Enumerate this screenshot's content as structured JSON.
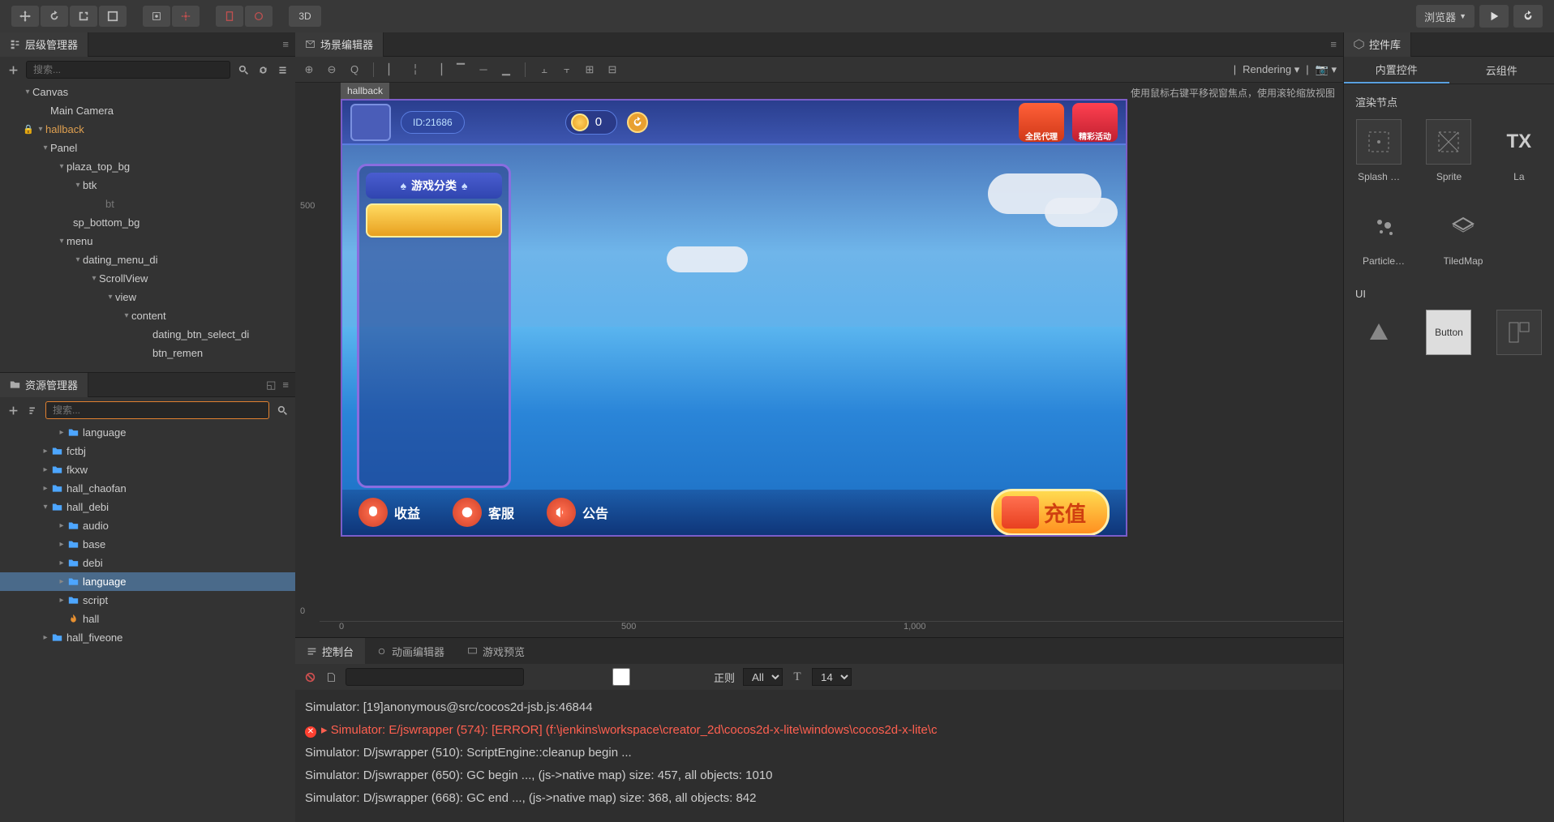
{
  "toolbar": {
    "btn3d": "3D",
    "browser": "浏览器"
  },
  "panels": {
    "hierarchy_title": "层级管理器",
    "assets_title": "资源管理器",
    "scene_title": "场景编辑器",
    "widgets_title": "控件库",
    "console_title": "控制台",
    "anim_title": "动画编辑器",
    "preview_title": "游戏预览"
  },
  "search": {
    "placeholder": "搜索..."
  },
  "hierarchy": {
    "items": [
      {
        "pad": 28,
        "caret": "▾",
        "label": "Canvas"
      },
      {
        "pad": 50,
        "caret": "",
        "label": "Main Camera"
      },
      {
        "pad": 28,
        "caret": "▾",
        "label": "hallback",
        "active": true,
        "lock": true
      },
      {
        "pad": 50,
        "caret": "▾",
        "label": "Panel"
      },
      {
        "pad": 70,
        "caret": "▾",
        "label": "plaza_top_bg"
      },
      {
        "pad": 90,
        "caret": "▾",
        "label": "btk"
      },
      {
        "pad": 118,
        "caret": "",
        "label": "bt",
        "dim": true
      },
      {
        "pad": 78,
        "caret": "",
        "label": "sp_bottom_bg"
      },
      {
        "pad": 70,
        "caret": "▾",
        "label": "menu"
      },
      {
        "pad": 90,
        "caret": "▾",
        "label": "dating_menu_di"
      },
      {
        "pad": 110,
        "caret": "▾",
        "label": "ScrollView"
      },
      {
        "pad": 130,
        "caret": "▾",
        "label": "view"
      },
      {
        "pad": 150,
        "caret": "▾",
        "label": "content"
      },
      {
        "pad": 176,
        "caret": "",
        "label": "dating_btn_select_di"
      },
      {
        "pad": 176,
        "caret": "",
        "label": "btn_remen"
      }
    ]
  },
  "assets": {
    "items": [
      {
        "pad": 70,
        "caret": "▸",
        "folder": true,
        "label": "language"
      },
      {
        "pad": 50,
        "caret": "▸",
        "folder": true,
        "label": "fctbj"
      },
      {
        "pad": 50,
        "caret": "▸",
        "folder": true,
        "label": "fkxw"
      },
      {
        "pad": 50,
        "caret": "▸",
        "folder": true,
        "label": "hall_chaofan"
      },
      {
        "pad": 50,
        "caret": "▾",
        "folder": true,
        "label": "hall_debi"
      },
      {
        "pad": 70,
        "caret": "▸",
        "folder": true,
        "label": "audio"
      },
      {
        "pad": 70,
        "caret": "▸",
        "folder": true,
        "label": "base"
      },
      {
        "pad": 70,
        "caret": "▸",
        "folder": true,
        "label": "debi"
      },
      {
        "pad": 70,
        "caret": "▸",
        "folder": true,
        "label": "language",
        "sel": true
      },
      {
        "pad": 70,
        "caret": "▸",
        "folder": true,
        "label": "script"
      },
      {
        "pad": 70,
        "caret": "",
        "folder": false,
        "label": "hall",
        "fire": true
      },
      {
        "pad": 50,
        "caret": "▸",
        "folder": true,
        "label": "hall_fiveone"
      }
    ]
  },
  "scene": {
    "node_label": "hallback",
    "hint": "使用鼠标右键平移视窗焦点，使用滚轮缩放视图",
    "rendering": "Rendering",
    "ruler_h": [
      "0",
      "500",
      "1,000"
    ],
    "ruler_v": [
      "500",
      "0"
    ]
  },
  "game": {
    "id_label": "ID:21686",
    "coin_value": "0",
    "menu_title": "游戏分类",
    "badge1": "全民代理",
    "badge2": "精彩活动",
    "bottom": [
      "收益",
      "客服",
      "公告"
    ],
    "recharge": "充值"
  },
  "console": {
    "regex_label": "正则",
    "filter_all": "All",
    "font_size": "14",
    "lines": [
      {
        "t": "Simulator: [19]anonymous@src/cocos2d-jsb.js:46844"
      },
      {
        "t": "Simulator: E/jswrapper (574): [ERROR] (f:\\jenkins\\workspace\\creator_2d\\cocos2d-x-lite\\windows\\cocos2d-x-lite\\c",
        "err": true
      },
      {
        "t": "Simulator: D/jswrapper (510): ScriptEngine::cleanup begin ..."
      },
      {
        "t": "Simulator: D/jswrapper (650): GC begin ..., (js->native map) size: 457, all objects: 1010"
      },
      {
        "t": "Simulator: D/jswrapper (668): GC end ..., (js->native map) size: 368, all objects: 842"
      }
    ]
  },
  "widgets": {
    "tab_builtin": "内置控件",
    "tab_cloud": "云组件",
    "section_render": "渲染节点",
    "section_ui": "UI",
    "render_items": [
      "Splash …",
      "Sprite",
      "La"
    ],
    "render_items2": [
      "Particle…",
      "TiledMap"
    ],
    "ui_button_label": "Button",
    "tx_label": "TX"
  }
}
